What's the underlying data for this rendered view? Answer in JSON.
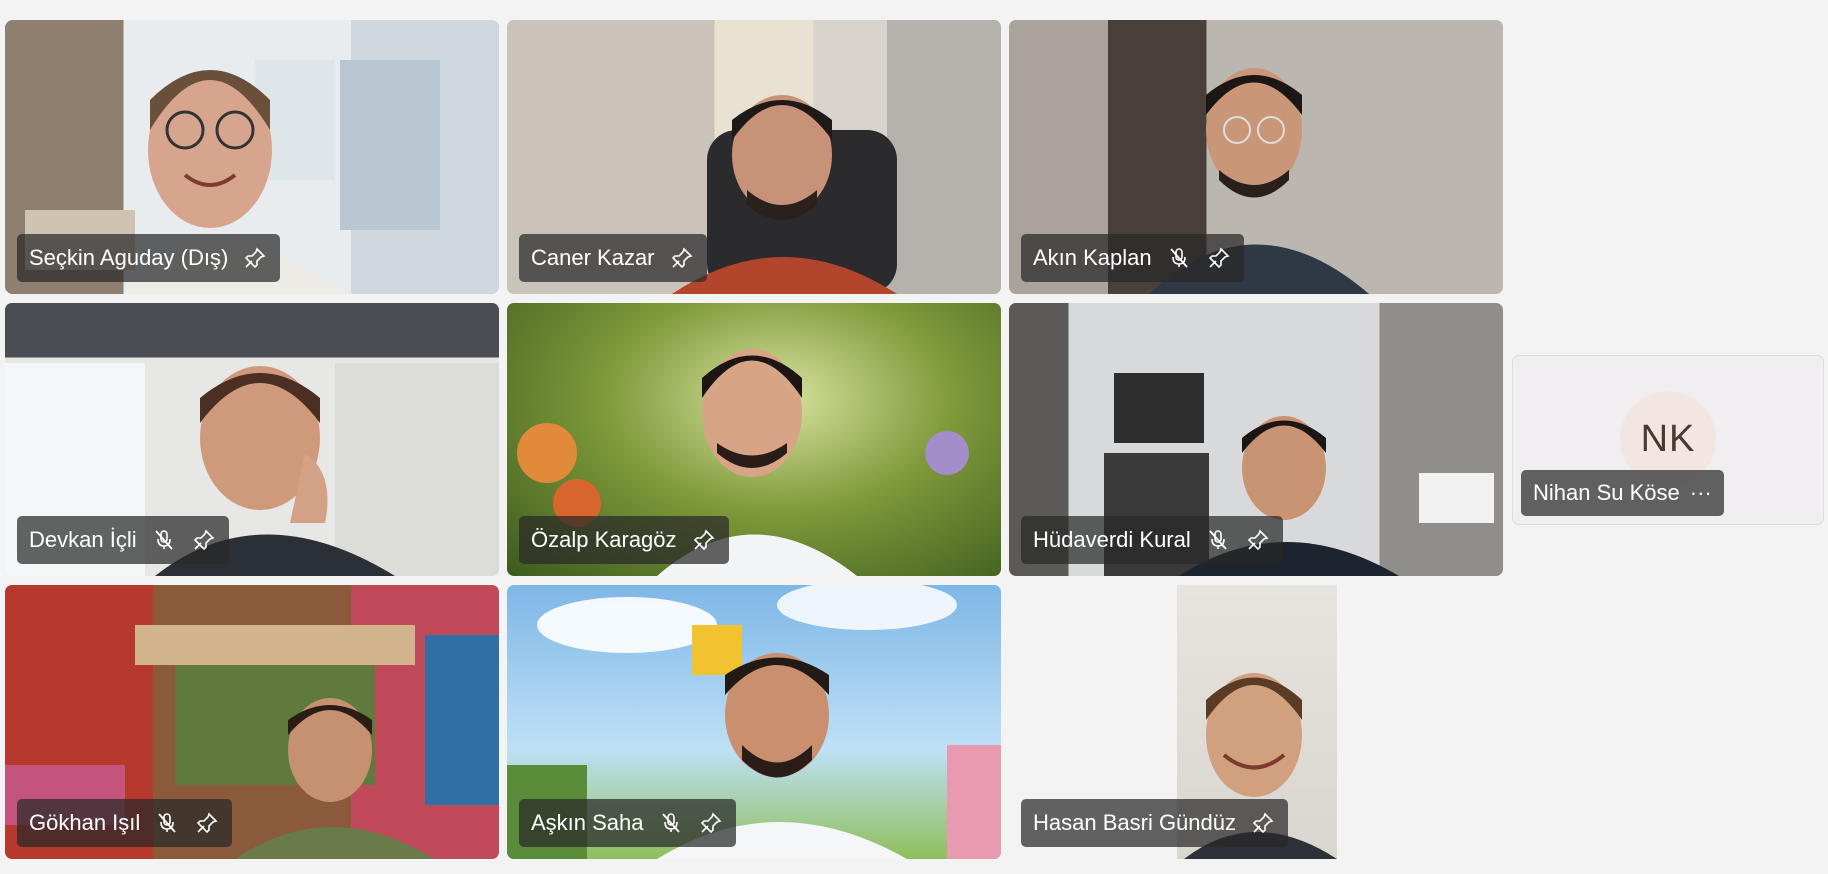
{
  "participants": [
    {
      "name": "Seçkin Aguday (Dış)",
      "muted": false,
      "active": true
    },
    {
      "name": "Caner Kazar",
      "muted": false,
      "active": false
    },
    {
      "name": "Akın Kaplan",
      "muted": true,
      "active": false
    },
    {
      "name": "Devkan İçli",
      "muted": true,
      "active": false
    },
    {
      "name": "Özalp Karagöz",
      "muted": false,
      "active": false
    },
    {
      "name": "Hüdaverdi Kural",
      "muted": true,
      "active": false
    },
    {
      "name": "Gökhan Işıl",
      "muted": true,
      "active": false
    },
    {
      "name": "Aşkın Saha",
      "muted": true,
      "active": false
    },
    {
      "name": "Hasan Basri Gündüz",
      "muted": false,
      "active": false
    }
  ],
  "avatar_participant": {
    "name": "Nihan Su Köse",
    "initials": "NK",
    "more": "···"
  },
  "colors": {
    "active_border": "#6264d8",
    "background": "#f3f3f3"
  },
  "icons": {
    "pin": "pin-icon",
    "mute": "mic-off-icon",
    "more": "more-options-icon"
  }
}
